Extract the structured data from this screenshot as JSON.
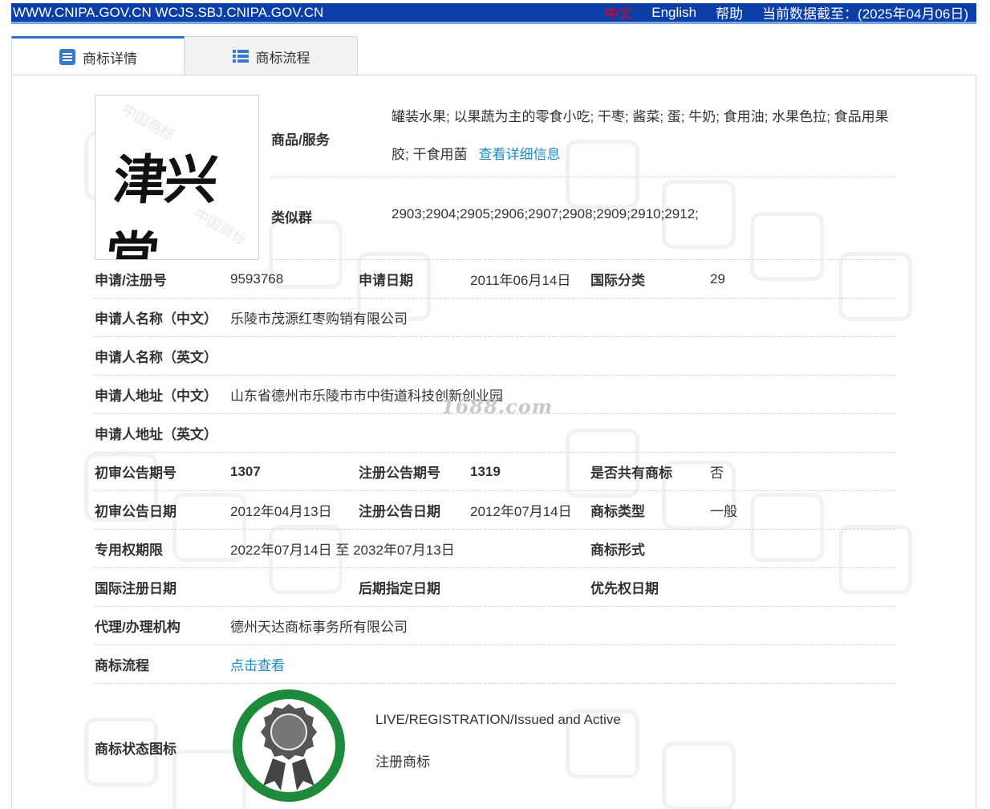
{
  "topbar": {
    "sites": "WWW.CNIPA.GOV.CN WCJS.SBJ.CNIPA.GOV.CN",
    "lang_cn": "中文",
    "lang_en": "English",
    "help": "帮助",
    "data_date": "当前数据截至：(2025年04月06日)"
  },
  "tabs": [
    {
      "label": "商标详情",
      "icon": "document-list-icon",
      "active": true
    },
    {
      "label": "商标流程",
      "icon": "bullet-list-icon",
      "active": false
    }
  ],
  "logo": {
    "mark_text": "津兴堂",
    "watermark": "中国商标"
  },
  "goods": {
    "label": "商品/服务",
    "value": "罐装水果; 以果蔬为主的零食小吃; 干枣; 酱菜; 蛋; 牛奶; 食用油; 水果色拉; 食品用果胶; 干食用菌",
    "detail_link": "查看详细信息"
  },
  "similar": {
    "label": "类似群",
    "value": "2903;2904;2905;2906;2907;2908;2909;2910;2912;"
  },
  "fields": {
    "reg_no_label": "申请/注册号",
    "reg_no": "9593768",
    "apply_date_label": "申请日期",
    "apply_date": "2011年06月14日",
    "intl_class_label": "国际分类",
    "intl_class": "29",
    "applicant_cn_label": "申请人名称（中文）",
    "applicant_cn": "乐陵市茂源红枣购销有限公司",
    "applicant_en_label": "申请人名称（英文）",
    "applicant_en": "",
    "address_cn_label": "申请人地址（中文）",
    "address_cn": "山东省德州市乐陵市市中街道科技创新创业园",
    "address_en_label": "申请人地址（英文）",
    "address_en": "",
    "prelim_no_label": "初审公告期号",
    "prelim_no": "1307",
    "reg_pub_no_label": "注册公告期号",
    "reg_pub_no": "1319",
    "shared_label": "是否共有商标",
    "shared": "否",
    "prelim_date_label": "初审公告日期",
    "prelim_date": "2012年04月13日",
    "reg_pub_date_label": "注册公告日期",
    "reg_pub_date": "2012年07月14日",
    "type_label": "商标类型",
    "type": "一般",
    "term_label": "专用权期限",
    "term": "2022年07月14日 至 2032年07月13日",
    "form_label": "商标形式",
    "form": "",
    "intl_reg_date_label": "国际注册日期",
    "intl_reg_date": "",
    "later_date_label": "后期指定日期",
    "later_date": "",
    "priority_date_label": "优先权日期",
    "priority_date": "",
    "agent_label": "代理/办理机构",
    "agent": "德州天达商标事务所有限公司",
    "process_label": "商标流程",
    "process_link": "点击查看"
  },
  "status": {
    "label": "商标状态图标",
    "en": "LIVE/REGISTRATION/Issued and Active",
    "cn": "注册商标",
    "icon": "award-ribbon-icon"
  },
  "watermark_site": "1688.com",
  "colors": {
    "topbar": "#0b3ea6",
    "link": "#1a8bc7",
    "badge_ring": "#1e8a3c",
    "badge_seal": "#444444"
  }
}
